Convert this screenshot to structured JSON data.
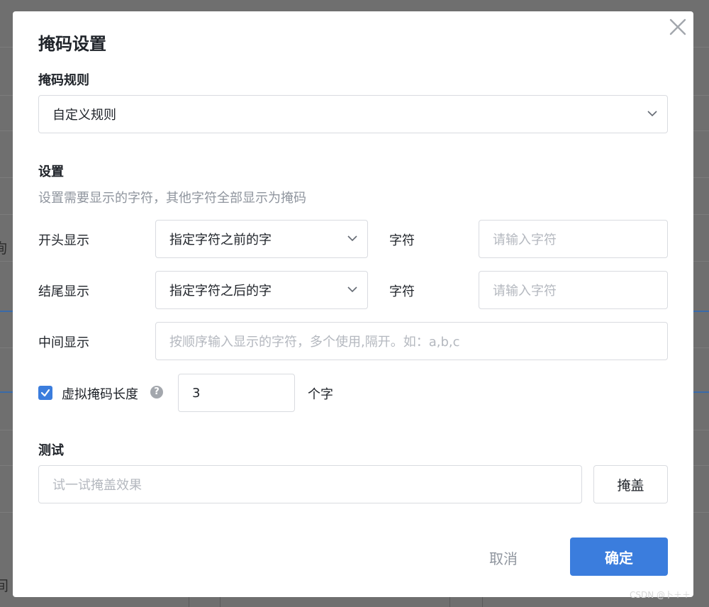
{
  "dialog": {
    "title": "掩码设置",
    "rule_label": "掩码规则",
    "rule_value": "自定义规则",
    "settings_label": "设置",
    "settings_hint": "设置需要显示的字符，其他字符全部显示为掩码",
    "start_label": "开头显示",
    "start_select": "指定字符之前的字",
    "start_char_label": "字符",
    "start_char_placeholder": "请输入字符",
    "end_label": "结尾显示",
    "end_select": "指定字符之后的字",
    "end_char_label": "字符",
    "end_char_placeholder": "请输入字符",
    "middle_label": "中间显示",
    "middle_placeholder": "按顺序输入显示的字符，多个使用,隔开。如：a,b,c",
    "virtual_label": "虚拟掩码长度",
    "virtual_checked": true,
    "help_glyph": "?",
    "virtual_value": "3",
    "virtual_unit": "个字",
    "test_label": "测试",
    "test_placeholder": "试一试掩盖效果",
    "mask_button": "掩盖",
    "cancel_button": "取消",
    "confirm_button": "确定"
  },
  "background": {
    "fragment_left_top": "询",
    "fragment_left_bottom": "间"
  },
  "watermark": "CSDN @卜＋＋",
  "colors": {
    "primary": "#3b7ddd",
    "overlay": "#6f6f6f",
    "placeholder": "#b4b8bf",
    "text": "#1f2329"
  }
}
